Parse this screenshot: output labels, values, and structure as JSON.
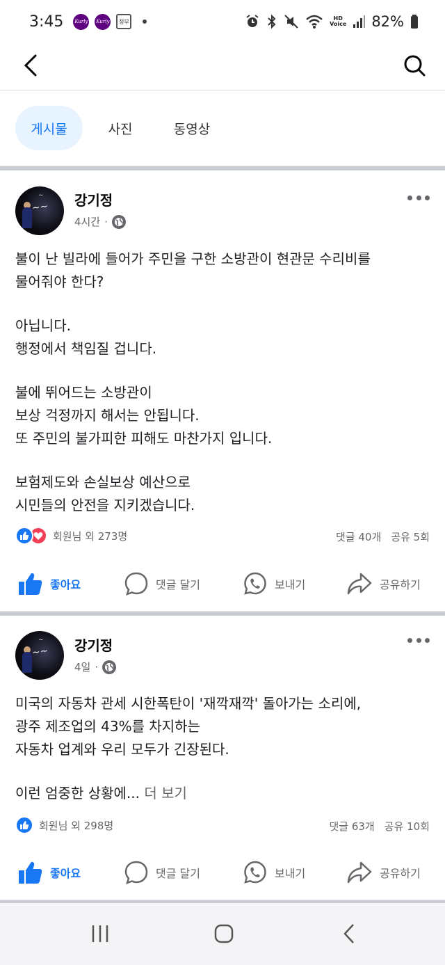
{
  "status": {
    "time": "3:45",
    "notif_app_1": "Kurly",
    "notif_app_2": "Kurly",
    "notif_app_3": "정부",
    "hd_top": "HD",
    "hd_bottom": "Voice",
    "battery": "82%"
  },
  "header": {
    "back_icon": "chevron-left-icon",
    "search_icon": "search-icon"
  },
  "tabs": [
    {
      "label": "게시물",
      "active": true
    },
    {
      "label": "사진",
      "active": false
    },
    {
      "label": "동영상",
      "active": false
    }
  ],
  "posts": [
    {
      "author": "강기정",
      "time": "4시간",
      "separator": "·",
      "paragraphs": [
        [
          "불이 난 빌라에 들어가 주민을 구한 소방관이 현관문 수리비를",
          "물어줘야 한다?"
        ],
        [
          "아닙니다.",
          "행정에서 책임질 겁니다."
        ],
        [
          "불에 뛰어드는 소방관이",
          "보상 걱정까지 해서는 안됩니다.",
          "또 주민의 불가피한 피해도 마찬가지 입니다."
        ],
        [
          "보험제도와 손실보상 예산으로",
          "시민들의 안전을 지키겠습니다."
        ]
      ],
      "reactions_text": "회원님 외 273명",
      "comments": "댓글 40개",
      "shares": "공유 5회"
    },
    {
      "author": "강기정",
      "time": "4일",
      "separator": "·",
      "paragraphs": [
        [
          "미국의 자동차 관세 시한폭탄이 '재깍재깍' 돌아가는 소리에,",
          "광주 제조업의 43%를 차지하는",
          "자동차 업계와 우리 모두가 긴장된다."
        ]
      ],
      "truncated_line": "이런 엄중한 상황에...",
      "see_more": "더 보기",
      "reactions_text": "회원님 외 298명",
      "comments": "댓글 63개",
      "shares": "공유 10회"
    }
  ],
  "actions": {
    "like": "좋아요",
    "comment": "댓글 달기",
    "send": "보내기",
    "share": "공유하기"
  },
  "colors": {
    "brand": "#1877f2",
    "love": "#f33e58",
    "secondary_text": "#65676b",
    "active_tab_bg": "#e7f3ff"
  }
}
